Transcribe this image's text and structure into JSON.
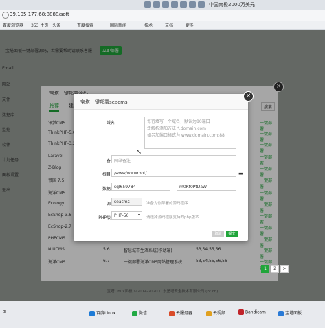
{
  "browser": {
    "address": "39.105.177.68:8888/soft",
    "news_badge": "中国南极2000万美元",
    "bookmarks": [
      "百度浏览器",
      "353 主页 · 头条",
      "百度搜索",
      "国际新闻",
      "技术",
      "文档",
      "更多"
    ]
  },
  "page": {
    "notice_text": "宝塔面板一键部署源码，若需要帮助请联系客服",
    "notice_button": "立即部署",
    "left_items": [
      "Email",
      "网站",
      "文件",
      "数据库",
      "监控",
      "软件",
      "计划任务",
      "面板设置",
      "退出"
    ],
    "footer": "宝塔Linux面板 ©2014-2020 广东堡塔安全技术有限公司 (bt.cn)"
  },
  "list_dialog": {
    "title": "宝塔一键部署源码",
    "tabs": [
      "推荐",
      "建站"
    ],
    "search_label": "搜索",
    "rows": [
      {
        "name": "讯梦CMS",
        "version": "",
        "desc": "",
        "hosts": "",
        "action": "一键部署"
      },
      {
        "name": "ThinkPHP-5.0",
        "version": "",
        "desc": "",
        "hosts": "",
        "action": "一键部署"
      },
      {
        "name": "ThinkPHP-3.2",
        "version": "",
        "desc": "",
        "hosts": "",
        "action": "一键部署"
      },
      {
        "name": "Laravel",
        "version": "",
        "desc": "",
        "hosts": "",
        "action": "一键部署"
      },
      {
        "name": "Z-Blog",
        "version": "",
        "desc": "",
        "hosts": "",
        "action": "一键部署"
      },
      {
        "name": "帝国 7.5",
        "version": "",
        "desc": "",
        "hosts": "",
        "action": "一键部署"
      },
      {
        "name": "海洋CMS",
        "version": "",
        "desc": "",
        "hosts": "",
        "action": "一键部署"
      },
      {
        "name": "Ecology",
        "version": "",
        "desc": "",
        "hosts": "",
        "action": "一键部署"
      },
      {
        "name": "EcShop-3.6",
        "version": "",
        "desc": "",
        "hosts": "",
        "action": "一键部署"
      },
      {
        "name": "EcShop-2.7",
        "version": "",
        "desc": "",
        "hosts": "",
        "action": "一键部署"
      },
      {
        "name": "PHPCMS",
        "version": "",
        "desc": "",
        "hosts": "",
        "action": "一键部署"
      },
      {
        "name": "NIUCMS",
        "version": "5.6",
        "desc": "智慧城市生活系统(移动端)",
        "hosts": "53,54,55,56",
        "action": "一键部署"
      },
      {
        "name": "海洋CMS",
        "version": "6.7",
        "desc": "一键部署海洋CMS网站管理系统",
        "hosts": "53,54,55,56,56",
        "action": "一键部署"
      }
    ],
    "pages": [
      "1",
      "2",
      ">"
    ]
  },
  "deploy_dialog": {
    "title": "宝塔一键部署seacms",
    "domain_label": "域名",
    "domain_placeholder": "每行填写一个域名，默认为80端口\n泛解析添加方法 *.domain.com\n如另加端口格式为 www.domain.com:88",
    "remark_label": "备注",
    "remark_placeholder": "网站备注",
    "root_label": "根目录",
    "root_value": "/www/wwwroot/",
    "db_label": "数据库",
    "db_user": "sql659784",
    "db_pass": "m0Kt0PtDaW",
    "source_label": "源码",
    "source_value": "seacms",
    "source_hint": "准备为你部署的源码程序",
    "php_label": "PHP版本",
    "php_value": "PHP-56",
    "php_hint": "请选择源码程序支持的php版本",
    "cancel_label": "取消",
    "ok_label": "提交"
  },
  "taskbar": {
    "items": [
      "百度Linux...",
      "微信",
      "云服务器...",
      "云视频",
      "Bandicam",
      "宝塔面板..."
    ]
  }
}
